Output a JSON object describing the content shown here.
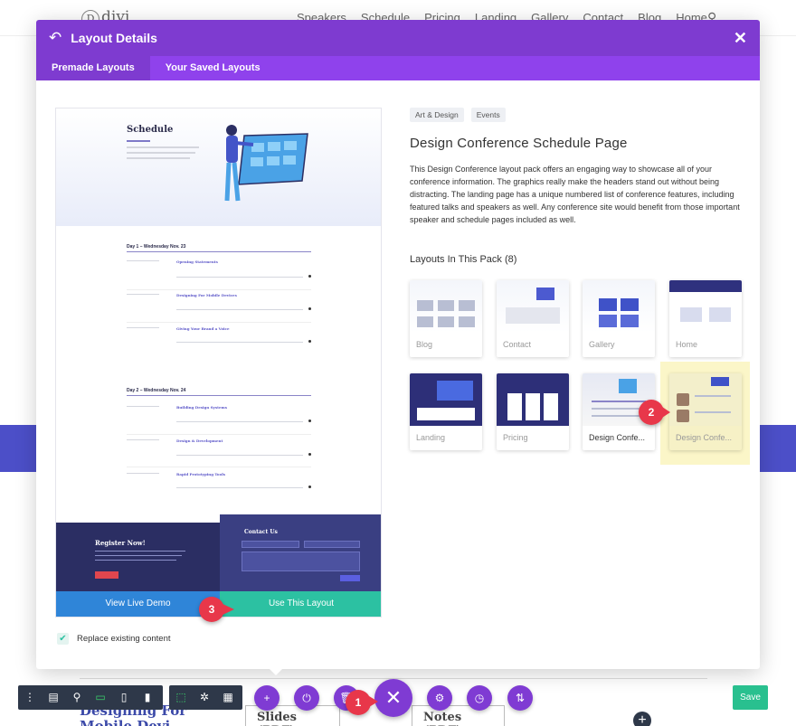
{
  "background": {
    "logo": "divi",
    "menu": [
      "Speakers",
      "Schedule",
      "Pricing",
      "Landing",
      "Gallery",
      "Contact",
      "Blog",
      "Home"
    ],
    "heading_lines": [
      "Designing For",
      "Mobile Devi"
    ],
    "bottom_tabs": [
      "Slides (PDF)",
      "Notes (PDF)"
    ]
  },
  "modal": {
    "title": "Layout Details",
    "tabs": [
      "Premade Layouts",
      "Your Saved Layouts"
    ],
    "active_tab": "Premade Layouts"
  },
  "preview": {
    "hero_title": "Schedule",
    "day1": "Day 1 – Wednesday Nov. 23",
    "day2": "Day 2 – Wednesday Nov. 24",
    "day1_items": [
      "Opening Statements",
      "Designing For Mobile Devices",
      "Giving Your Brand a Voice"
    ],
    "day2_items": [
      "Building Design Systems",
      "Design & Development",
      "Rapid Prototyping Tools"
    ],
    "register": "Register Now!",
    "contact": "Contact Us",
    "view_demo": "View Live Demo",
    "use_layout": "Use This Layout"
  },
  "replace_label": "Replace existing content",
  "replace_checked": true,
  "details": {
    "tags": [
      "Art & Design",
      "Events"
    ],
    "title": "Design Conference Schedule Page",
    "description": "This Design Conference layout pack offers an engaging way to showcase all of your conference information. The graphics really make the headers stand out without being distracting. The landing page has a unique numbered list of conference features, including featured talks and speakers as well. Any conference site would benefit from those important speaker and schedule pages included as well.",
    "pack_title": "Layouts In This Pack (8)",
    "layouts": [
      "Blog",
      "Contact",
      "Gallery",
      "Home",
      "Landing",
      "Pricing",
      "Design Confe...",
      "Design Confe..."
    ]
  },
  "badges": [
    "1",
    "2",
    "3"
  ],
  "toolbar": {
    "save": "Save",
    "left_icons": [
      "more-icon",
      "wireframe-icon",
      "zoom-icon",
      "desktop-icon",
      "tablet-icon",
      "phone-icon"
    ],
    "right_icons": [
      "select-icon",
      "click-mode-icon",
      "grid-icon"
    ],
    "center_icons": [
      "add-icon",
      "power-icon",
      "trash-icon",
      "close-icon",
      "settings-icon",
      "history-icon",
      "portability-icon"
    ]
  }
}
